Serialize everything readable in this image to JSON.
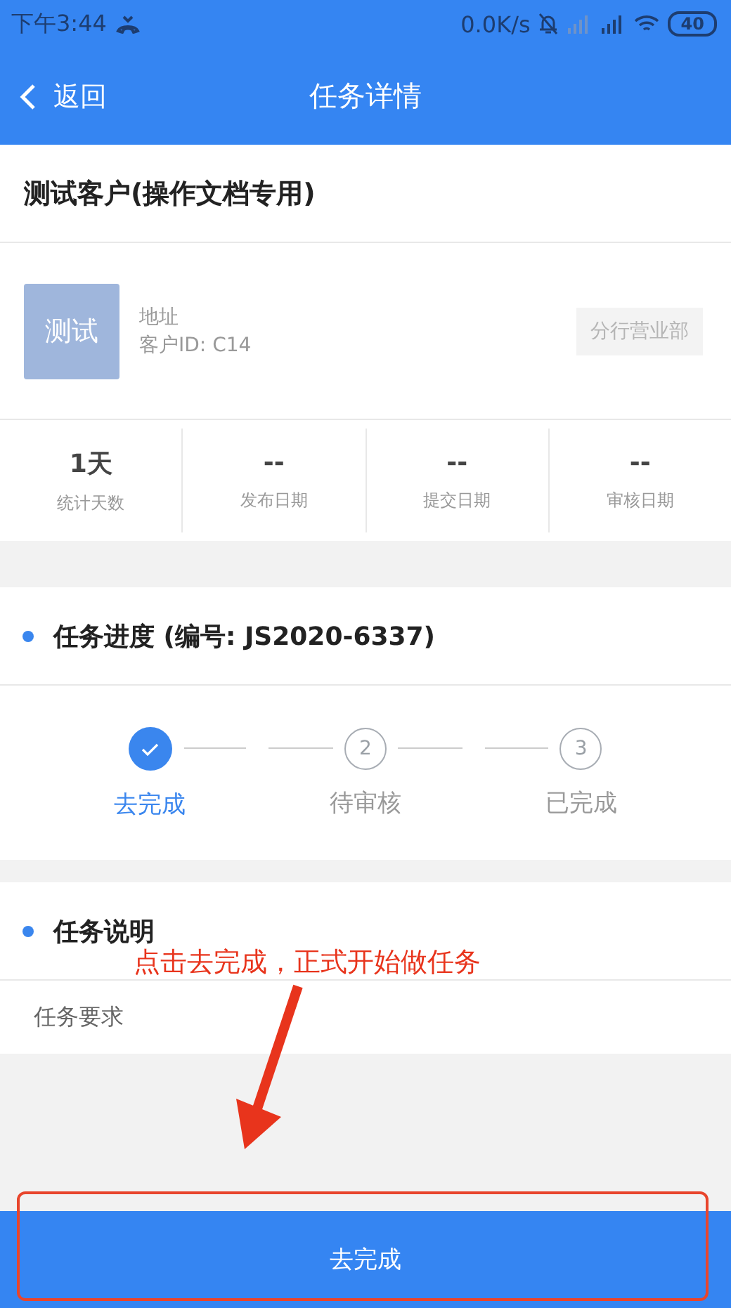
{
  "status_bar": {
    "time": "下午3:44",
    "speed": "0.0K/s",
    "battery": "40"
  },
  "header": {
    "back": "返回",
    "title": "任务详情"
  },
  "customer": {
    "name": "测试客户(操作文档专用)",
    "logo": "测试",
    "address": "地址",
    "customer_id": "客户ID: C14",
    "branch": "分行营业部"
  },
  "stats": [
    {
      "value": "1天",
      "label": "统计天数"
    },
    {
      "value": "--",
      "label": "发布日期"
    },
    {
      "value": "--",
      "label": "提交日期"
    },
    {
      "value": "--",
      "label": "审核日期"
    }
  ],
  "progress": {
    "heading": "任务进度 (编号: JS2020-6337)",
    "steps": [
      {
        "label": "去完成",
        "done": true
      },
      {
        "number": "2",
        "label": "待审核",
        "done": false
      },
      {
        "number": "3",
        "label": "已完成",
        "done": false
      }
    ]
  },
  "description": {
    "heading": "任务说明",
    "text": "任务要求"
  },
  "action_button": "去完成",
  "annotation": {
    "text": "点击去完成，正式开始做任务"
  }
}
